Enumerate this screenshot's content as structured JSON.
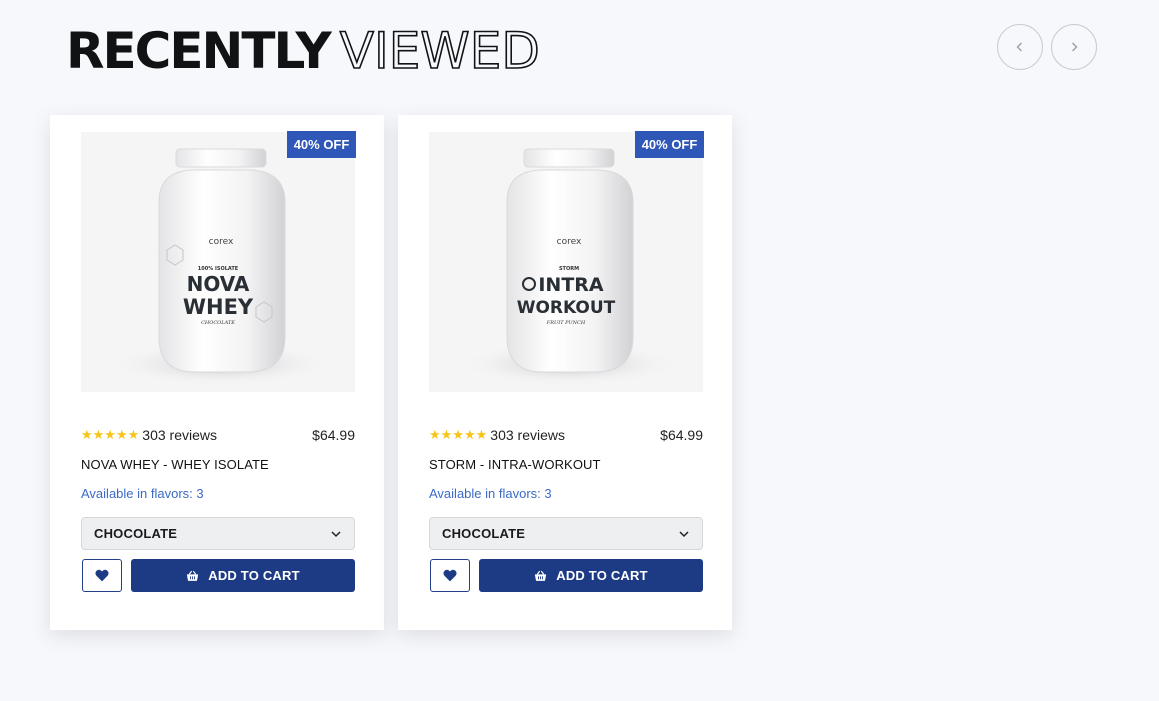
{
  "section": {
    "title_bold": "RECENTLY",
    "title_outline": "VIEWED"
  },
  "carousel": {
    "prev_icon": "chevron-left-icon",
    "next_icon": "chevron-right-icon"
  },
  "colors": {
    "accent": "#1d3b85",
    "badge": "#2f57b8",
    "star": "#f5c518",
    "link": "#3b6ac9"
  },
  "products": [
    {
      "badge": "40% OFF",
      "stars": "★★★★★",
      "rating": 5,
      "reviews": "303 reviews",
      "price": "$64.99",
      "name": "NOVA WHEY - WHEY ISOLATE",
      "flavors": "Available in flavors: 3",
      "selected_flavor": "CHOCOLATE",
      "cart_label": "ADD TO CART",
      "jar": {
        "brand": "corex",
        "subline": "100% ISOLATE",
        "line1": "NOVA",
        "line2": "WHEY",
        "flavor": "CHOCOLATE"
      }
    },
    {
      "badge": "40% OFF",
      "stars": "★★★★★",
      "rating": 5,
      "reviews": "303 reviews",
      "price": "$64.99",
      "name": "STORM - INTRA-WORKOUT",
      "flavors": "Available in flavors: 3",
      "selected_flavor": "CHOCOLATE",
      "cart_label": "ADD TO CART",
      "jar": {
        "brand": "corex",
        "subline": "STORM",
        "line1": "INTRA",
        "line2": "WORKOUT",
        "flavor": "FRUIT PUNCH"
      }
    }
  ]
}
